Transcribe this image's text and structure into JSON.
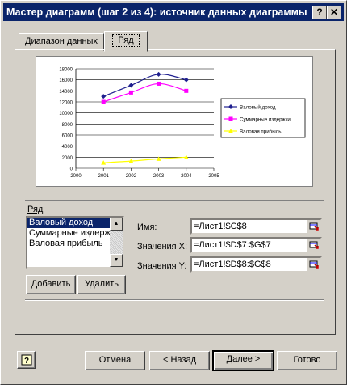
{
  "window": {
    "title": "Мастер диаграмм (шаг 2 из 4): источник данных диаграммы",
    "help_glyph": "?",
    "close_glyph": "✕"
  },
  "tabs": [
    {
      "label": "Диапазон данных",
      "active": false
    },
    {
      "label": "Ряд",
      "active": true
    }
  ],
  "chart_data": {
    "type": "line",
    "x": [
      2001,
      2002,
      2003,
      2004
    ],
    "xticks": [
      "2000",
      "2001",
      "2002",
      "2003",
      "2004",
      "2005"
    ],
    "yticks": [
      "0",
      "2000",
      "4000",
      "6000",
      "8000",
      "10000",
      "12000",
      "14000",
      "16000",
      "18000"
    ],
    "xlim": [
      2000,
      2005
    ],
    "ylim": [
      0,
      18000
    ],
    "grid": true,
    "legend_position": "right",
    "series": [
      {
        "name": "Валовый доход",
        "values": [
          13000,
          15000,
          17000,
          16000
        ],
        "color": "#1f1f8f",
        "marker": "diamond"
      },
      {
        "name": "Суммарные издержки",
        "values": [
          12000,
          13700,
          15300,
          14000
        ],
        "color": "#ff00ff",
        "marker": "square"
      },
      {
        "name": "Валовая прибыль",
        "values": [
          1000,
          1300,
          1700,
          2000
        ],
        "color": "#ffff00",
        "marker": "triangle"
      }
    ]
  },
  "series_panel": {
    "label": "Ряд",
    "items": [
      "Валовый доход",
      "Суммарные издержк",
      "Валовая прибыль"
    ],
    "selected_index": 0,
    "add_button": "Добавить",
    "remove_button": "Удалить"
  },
  "fields": {
    "name_label": "Имя:",
    "name_value": "=Лист1!$C$8",
    "x_label": "Значения X:",
    "x_value": "=Лист1!$D$7:$G$7",
    "y_label": "Значения Y:",
    "y_value": "=Лист1!$D$8:$G$8"
  },
  "footer": {
    "cancel": "Отмена",
    "back": "< Назад",
    "next": "Далее >",
    "finish": "Готово"
  }
}
